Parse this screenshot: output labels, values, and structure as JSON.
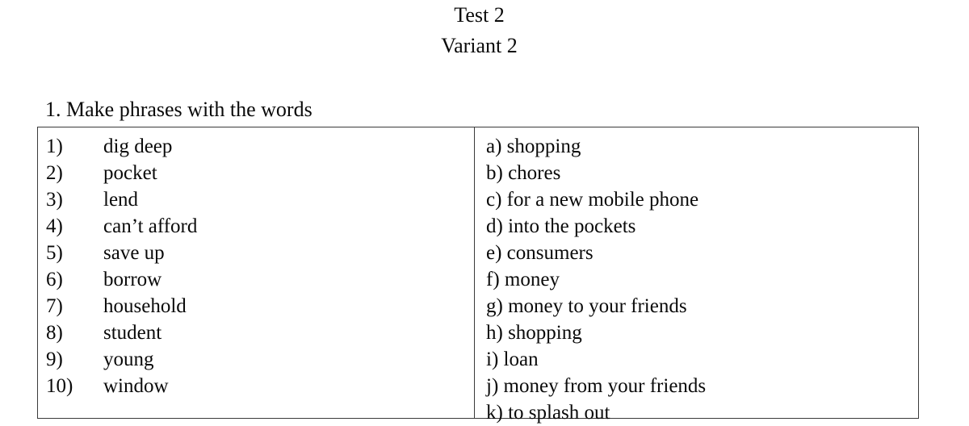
{
  "document": {
    "title": "Test 2",
    "subtitle": "Variant 2"
  },
  "task": {
    "heading": "1. Make phrases with the words"
  },
  "match_table": {
    "left_column": [
      {
        "marker": "1)",
        "text": "dig deep"
      },
      {
        "marker": "2)",
        "text": "pocket"
      },
      {
        "marker": "3)",
        "text": "lend"
      },
      {
        "marker": "4)",
        "text": "can’t afford"
      },
      {
        "marker": "5)",
        "text": "save up"
      },
      {
        "marker": "6)",
        "text": "borrow"
      },
      {
        "marker": "7)",
        "text": "household"
      },
      {
        "marker": "8)",
        "text": "student"
      },
      {
        "marker": "9)",
        "text": "young"
      },
      {
        "marker": "10)",
        "text": "window"
      }
    ],
    "right_column": [
      {
        "text": "a) shopping"
      },
      {
        "text": "b) chores"
      },
      {
        "text": "c) for a new mobile phone"
      },
      {
        "text": "d) into the pockets"
      },
      {
        "text": "e) consumers"
      },
      {
        "text": "f) money"
      },
      {
        "text": "g) money to your friends"
      },
      {
        "text": "h) shopping"
      },
      {
        "text": "i) loan"
      },
      {
        "text": "j) money from your friends"
      },
      {
        "text": "k) to splash out"
      }
    ]
  },
  "colors": {
    "text": "#0a0a0a",
    "border": "#3a3a3a",
    "background": "#ffffff"
  }
}
